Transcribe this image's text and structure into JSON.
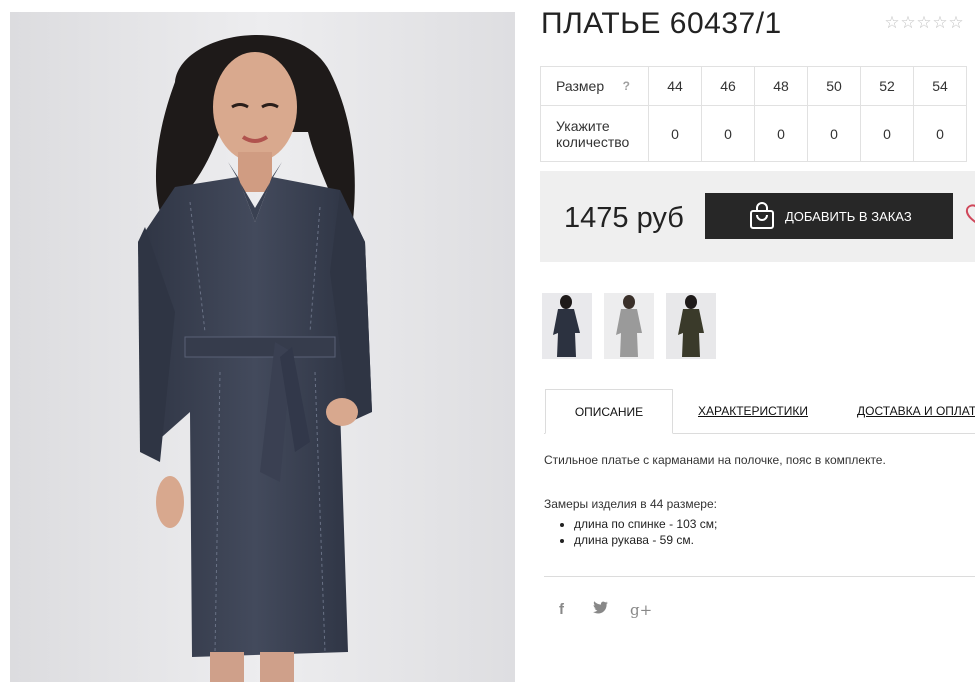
{
  "product": {
    "title": "ПЛАТЬЕ 60437/1",
    "rating_stars": [
      "☆",
      "☆",
      "☆",
      "☆",
      "☆"
    ],
    "image_alt": "dark grey wrap dress with belt"
  },
  "sizes": {
    "size_label": "Размер",
    "help_icon": "?",
    "qty_label": "Укажите количество",
    "values": [
      "44",
      "46",
      "48",
      "50",
      "52",
      "54"
    ],
    "quantities": [
      "0",
      "0",
      "0",
      "0",
      "0",
      "0"
    ]
  },
  "price": {
    "text": "1475 руб"
  },
  "cart": {
    "button_label": "ДОБАВИТЬ В ЗАКАЗ",
    "icon": "shopping-bag-icon",
    "wishlist_icon": "heart-icon"
  },
  "thumbnails": [
    {
      "name": "thumb-navy",
      "color": "#2c3240"
    },
    {
      "name": "thumb-grey",
      "color": "#9a9a9a"
    },
    {
      "name": "thumb-olive",
      "color": "#3a3a2a"
    }
  ],
  "tabs": [
    {
      "label": "ОПИСАНИЕ",
      "active": true
    },
    {
      "label": "ХАРАКТЕРИСТИКИ",
      "active": false
    },
    {
      "label": "ДОСТАВКА И ОПЛАТА",
      "active": false
    }
  ],
  "description": {
    "text": "Стильное платье с карманами на полочке, пояс в комплекте.",
    "measure_title": "Замеры изделия в 44 размере:",
    "measures": [
      "длина по спинке - 103 см;",
      "длина рукава - 59 см."
    ]
  },
  "social": [
    {
      "name": "facebook-icon",
      "glyph": "f"
    },
    {
      "name": "twitter-icon",
      "glyph": "t"
    },
    {
      "name": "google-plus-icon",
      "glyph": "g+"
    }
  ],
  "colors": {
    "accent_dark": "#272727",
    "price_bg": "#efefef",
    "dress": "#3a4152",
    "heart": "#d0475a"
  }
}
